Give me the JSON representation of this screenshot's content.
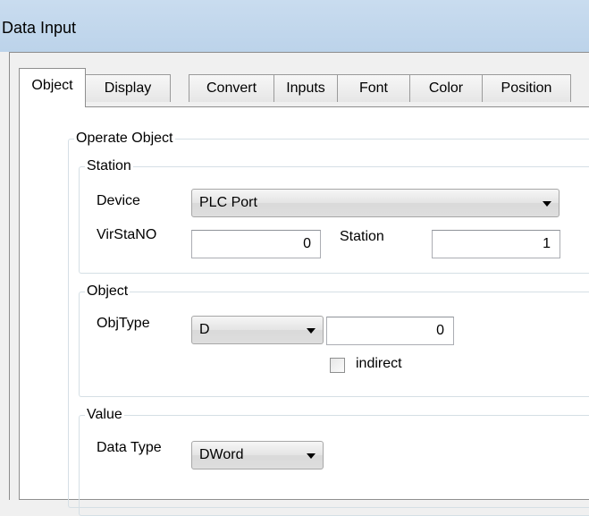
{
  "window": {
    "title": "Data Input"
  },
  "tabs": [
    {
      "label": "Object",
      "active": true
    },
    {
      "label": "Display"
    },
    {
      "label": "Convert"
    },
    {
      "label": "Inputs"
    },
    {
      "label": "Font"
    },
    {
      "label": "Color"
    },
    {
      "label": "Position"
    }
  ],
  "operate_object": {
    "legend": "Operate Object",
    "station": {
      "legend": "Station",
      "device_label": "Device",
      "device_value": "PLC Port",
      "virstano_label": "VirStaNO",
      "virstano_value": "0",
      "station_label": "Station",
      "station_value": "1"
    },
    "object": {
      "legend": "Object",
      "objtype_label": "ObjType",
      "objtype_value": "D",
      "address_value": "0",
      "indirect_label": "indirect",
      "indirect_checked": false
    },
    "value": {
      "legend": "Value",
      "datatype_label": "Data Type",
      "datatype_value": "DWord"
    }
  }
}
